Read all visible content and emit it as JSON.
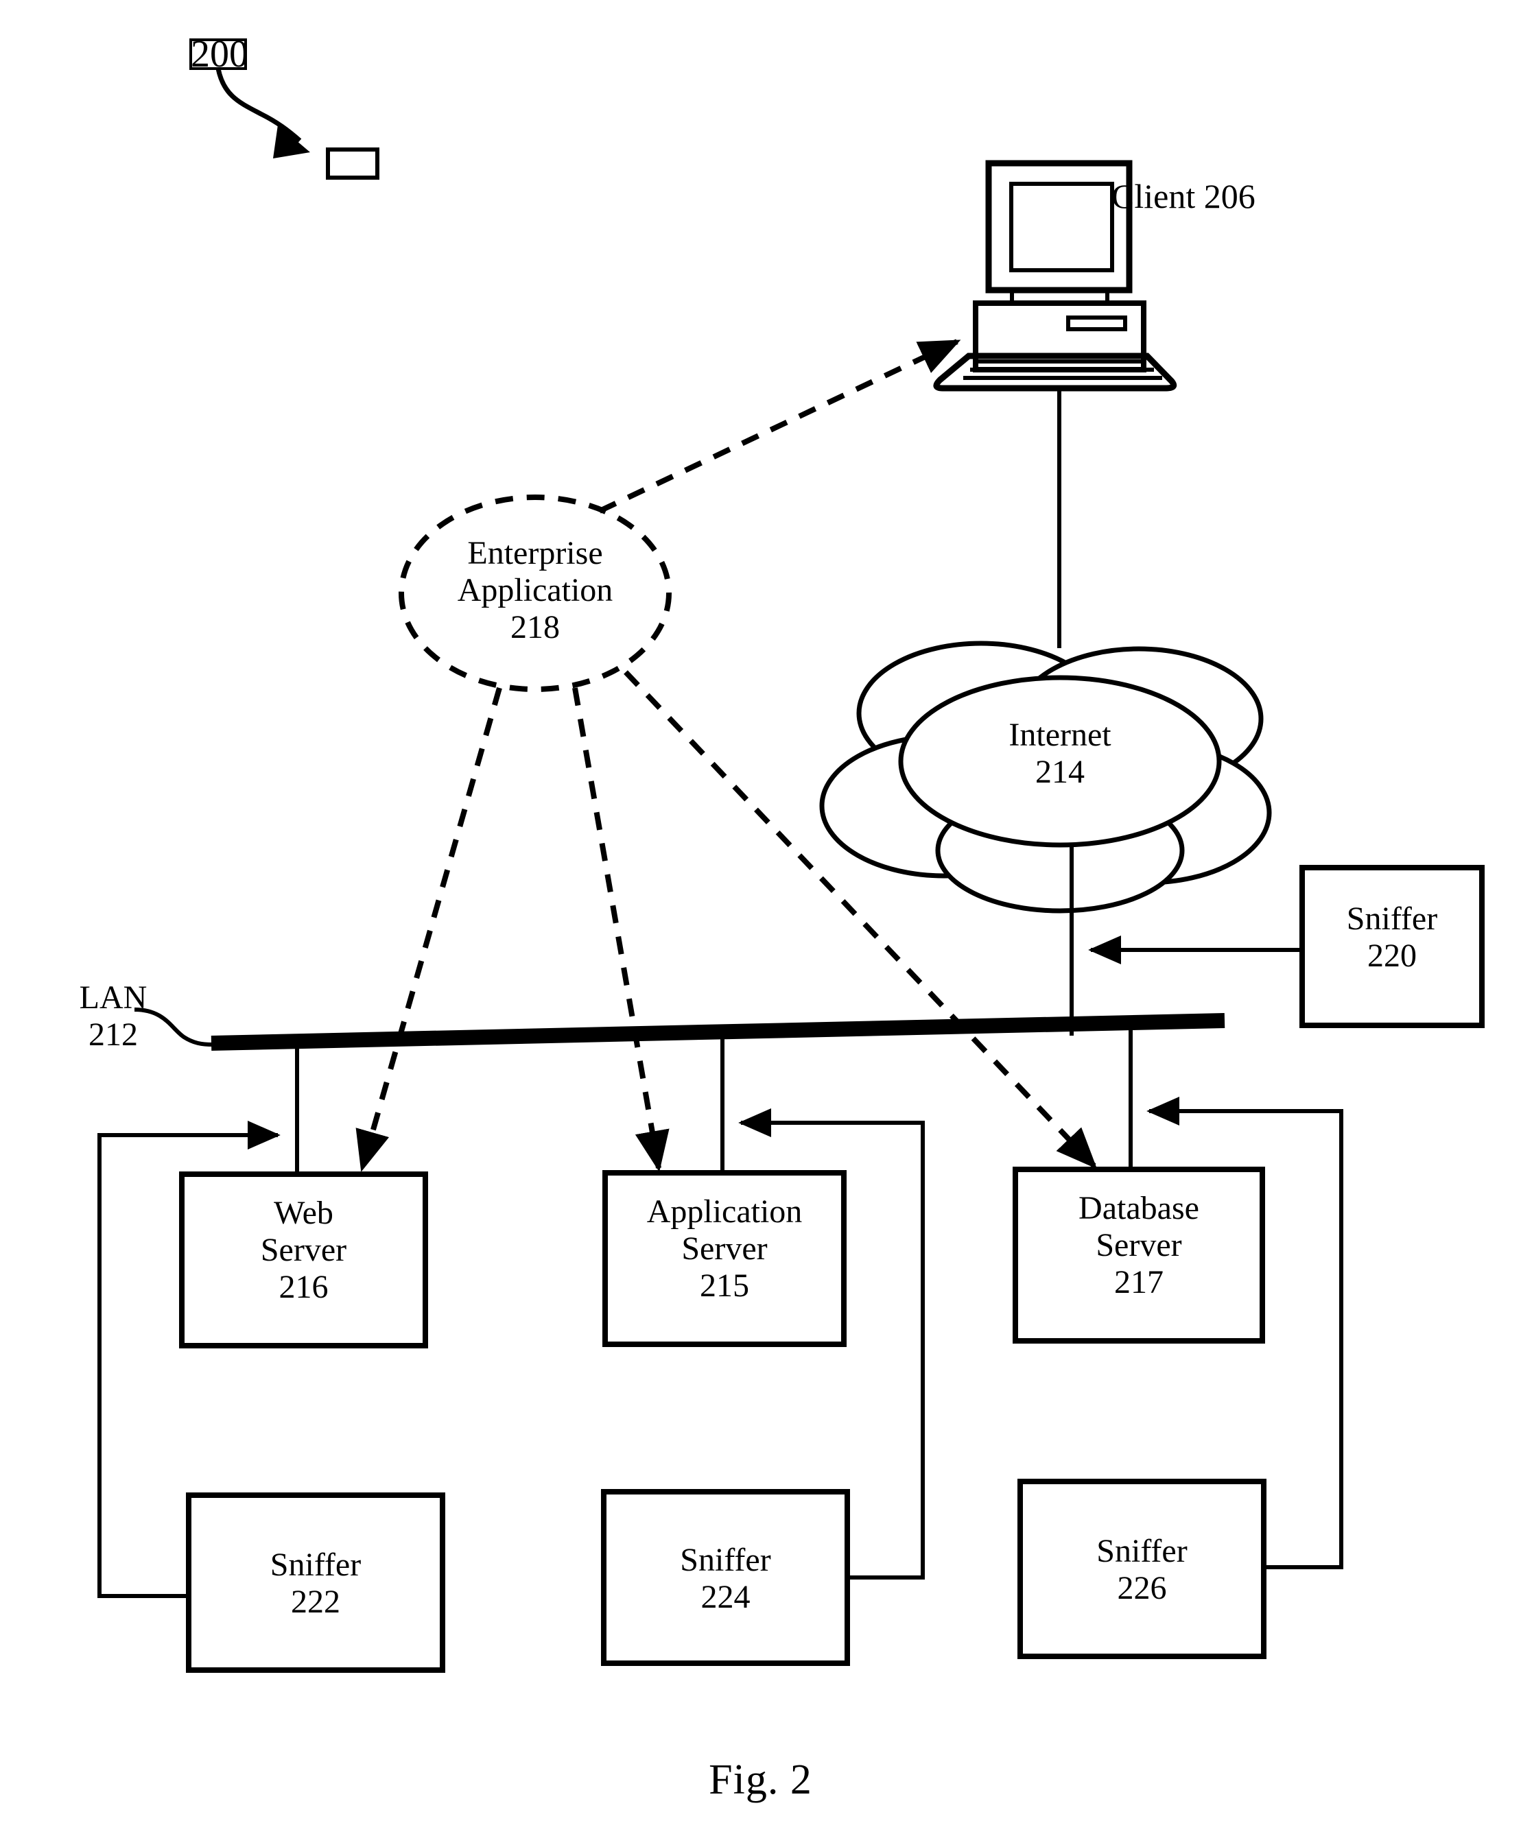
{
  "figure": {
    "caption": "Fig. 2",
    "reference_numeral": "200"
  },
  "nodes": {
    "client": {
      "label": "Client 206",
      "name": "Client",
      "numeral": "206"
    },
    "enterprise_application": {
      "line1": "Enterprise",
      "line2": "Application",
      "numeral": "218",
      "text": "Enterprise\nApplication\n218"
    },
    "internet": {
      "line1": "Internet",
      "numeral": "214",
      "text": "Internet\n214"
    },
    "lan": {
      "line1": "LAN",
      "numeral": "212",
      "text": "LAN\n212"
    },
    "web_server": {
      "line1": "Web",
      "line2": "Server",
      "numeral": "216",
      "text": "Web\nServer\n216"
    },
    "application_server": {
      "line1": "Application",
      "line2": "Server",
      "numeral": "215",
      "text": "Application\nServer\n215"
    },
    "database_server": {
      "line1": "Database",
      "line2": "Server",
      "numeral": "217",
      "text": "Database\nServer\n217"
    },
    "sniffer_220": {
      "line1": "Sniffer",
      "numeral": "220",
      "text": "Sniffer\n220"
    },
    "sniffer_222": {
      "line1": "Sniffer",
      "numeral": "222",
      "text": "Sniffer\n222"
    },
    "sniffer_224": {
      "line1": "Sniffer",
      "numeral": "224",
      "text": "Sniffer\n224"
    },
    "sniffer_226": {
      "line1": "Sniffer",
      "numeral": "226",
      "text": "Sniffer\n226"
    }
  },
  "style": {
    "ink": "#000000",
    "paper": "#ffffff"
  }
}
